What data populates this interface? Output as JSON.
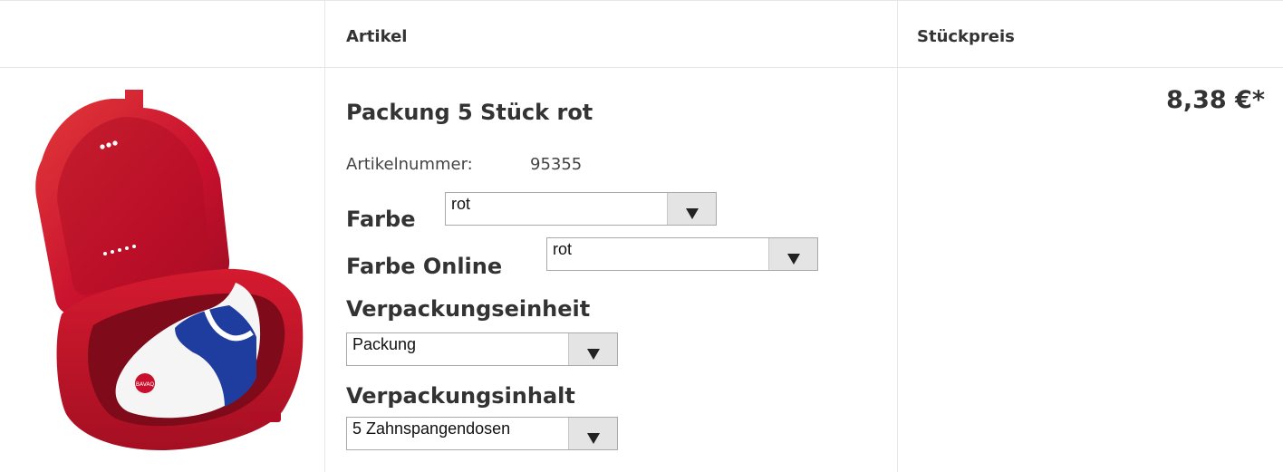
{
  "table": {
    "headers": {
      "artikel": "Artikel",
      "stueckpreis": "Stückpreis"
    }
  },
  "product": {
    "title": "Packung 5 Stück rot",
    "artikelnummer_label": "Artikelnummer:",
    "artikelnummer_value": "95355",
    "image_icon": "mouthguard-case-image",
    "price": "8,38 €*"
  },
  "options": {
    "farbe": {
      "label": "Farbe",
      "selected": "rot"
    },
    "farbe_online": {
      "label": "Farbe Online",
      "selected": "rot"
    },
    "verpackungseinheit": {
      "label": "Verpackungseinheit",
      "selected": "Packung"
    },
    "verpackungsinhalt": {
      "label": "Verpackungsinhalt",
      "selected": "5 Zahnspangendosen"
    }
  },
  "colors": {
    "case_red": "#c8102e",
    "guard_blue": "#1f3d9e",
    "border": "#e6e6e6"
  }
}
